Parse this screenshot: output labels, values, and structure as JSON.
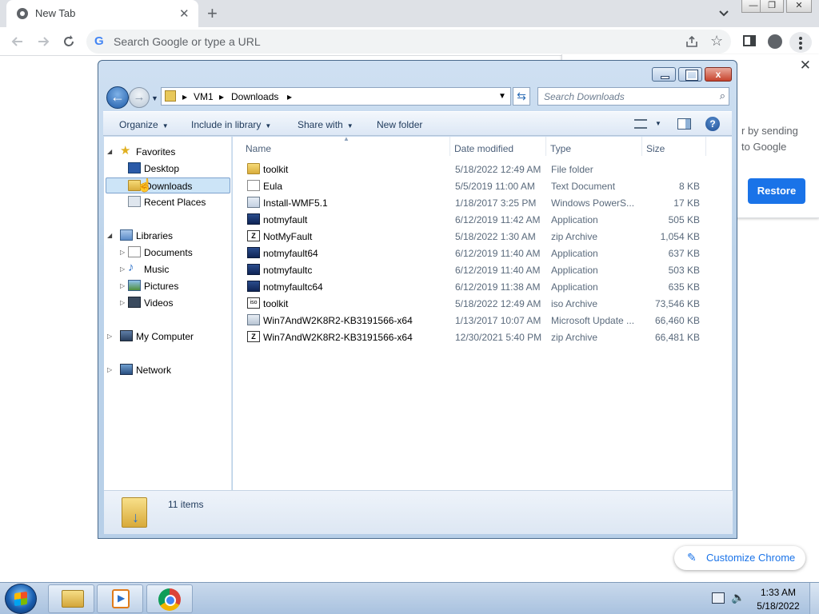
{
  "browser": {
    "tab_title": "New Tab",
    "tab_close": "✕",
    "new_tab": "+",
    "omnibox_placeholder": "Search Google or type a URL",
    "window_min": "—",
    "window_restore": "❐",
    "window_close": "✕",
    "restore_popup": {
      "line1": "r by sending",
      "line2": "to Google",
      "restore_label": "Restore",
      "close": "✕"
    },
    "customize_label": "Customize Chrome"
  },
  "explorer": {
    "close_glyph": "x",
    "back_glyph": "←",
    "forward_glyph": "→",
    "address": {
      "segments": [
        "VM1",
        "Downloads"
      ]
    },
    "search_placeholder": "Search Downloads",
    "commands": {
      "organize": "Organize",
      "include_in_library": "Include in library",
      "share_with": "Share with",
      "new_folder": "New folder"
    },
    "help_glyph": "?",
    "nav": {
      "favorites": "Favorites",
      "desktop": "Desktop",
      "downloads": "Downloads",
      "recent_places": "Recent Places",
      "libraries": "Libraries",
      "documents": "Documents",
      "music": "Music",
      "pictures": "Pictures",
      "videos": "Videos",
      "my_computer": "My Computer",
      "network": "Network"
    },
    "columns": {
      "name": "Name",
      "date_modified": "Date modified",
      "type": "Type",
      "size": "Size"
    },
    "files": [
      {
        "name": "toolkit",
        "date": "5/18/2022 12:49 AM",
        "type": "File folder",
        "size": "",
        "icon": "folder-icon"
      },
      {
        "name": "Eula",
        "date": "5/5/2019 11:00 AM",
        "type": "Text Document",
        "size": "8 KB",
        "icon": "text-document-icon"
      },
      {
        "name": "Install-WMF5.1",
        "date": "1/18/2017 3:25 PM",
        "type": "Windows PowerS...",
        "size": "17 KB",
        "icon": "powershell-script-icon"
      },
      {
        "name": "notmyfault",
        "date": "6/12/2019 11:42 AM",
        "type": "Application",
        "size": "505 KB",
        "icon": "application-icon"
      },
      {
        "name": "NotMyFault",
        "date": "5/18/2022 1:30 AM",
        "type": "zip Archive",
        "size": "1,054 KB",
        "icon": "zip-archive-icon"
      },
      {
        "name": "notmyfault64",
        "date": "6/12/2019 11:40 AM",
        "type": "Application",
        "size": "637 KB",
        "icon": "application-icon"
      },
      {
        "name": "notmyfaultc",
        "date": "6/12/2019 11:40 AM",
        "type": "Application",
        "size": "503 KB",
        "icon": "application-icon"
      },
      {
        "name": "notmyfaultc64",
        "date": "6/12/2019 11:38 AM",
        "type": "Application",
        "size": "635 KB",
        "icon": "application-icon"
      },
      {
        "name": "toolkit",
        "date": "5/18/2022 12:49 AM",
        "type": "iso Archive",
        "size": "73,546 KB",
        "icon": "iso-archive-icon"
      },
      {
        "name": "Win7AndW2K8R2-KB3191566-x64",
        "date": "1/13/2017 10:07 AM",
        "type": "Microsoft Update ...",
        "size": "66,460 KB",
        "icon": "update-package-icon"
      },
      {
        "name": "Win7AndW2K8R2-KB3191566-x64",
        "date": "12/30/2021 5:40 PM",
        "type": "zip Archive",
        "size": "66,481 KB",
        "icon": "zip-archive-icon"
      }
    ],
    "item_count": "11 items"
  },
  "taskbar": {
    "time": "1:33 AM",
    "date": "5/18/2022"
  },
  "colors": {
    "chrome_blue": "#1a73e8",
    "explorer_frame": "#bcd3ea",
    "selection": "#cce4f7"
  }
}
